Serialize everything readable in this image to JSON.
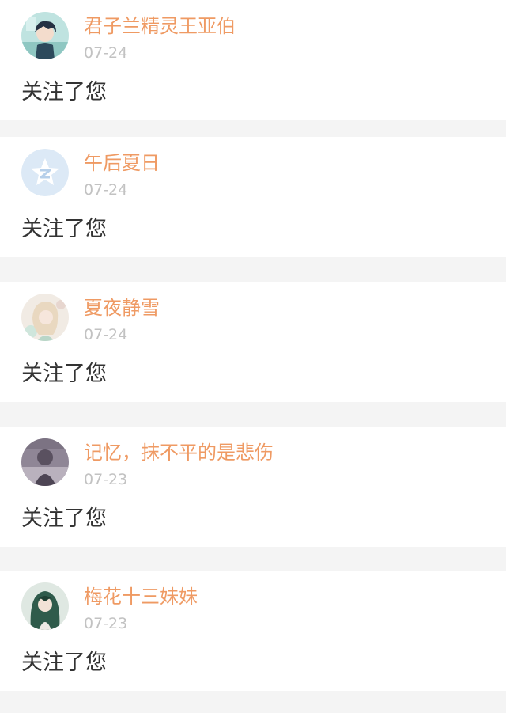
{
  "notifications": [
    {
      "username": "君子兰精灵王亚伯",
      "date": "07-24",
      "message": "关注了您",
      "avatar": "anime-boy-avatar"
    },
    {
      "username": "午后夏日",
      "date": "07-24",
      "message": "关注了您",
      "avatar": "default-star-avatar"
    },
    {
      "username": "夏夜静雪",
      "date": "07-24",
      "message": "关注了您",
      "avatar": "anime-girl-avatar"
    },
    {
      "username": "记忆，抹不平的是悲伤",
      "date": "07-23",
      "message": "关注了您",
      "avatar": "dark-portrait-avatar"
    },
    {
      "username": "梅花十三妹妹",
      "date": "07-23",
      "message": "关注了您",
      "avatar": "anime-green-hair-avatar"
    }
  ],
  "colors": {
    "username": "#ef9a63",
    "date": "#c2c2c2",
    "message": "#333333",
    "background": "#f4f4f4",
    "card": "#ffffff"
  }
}
